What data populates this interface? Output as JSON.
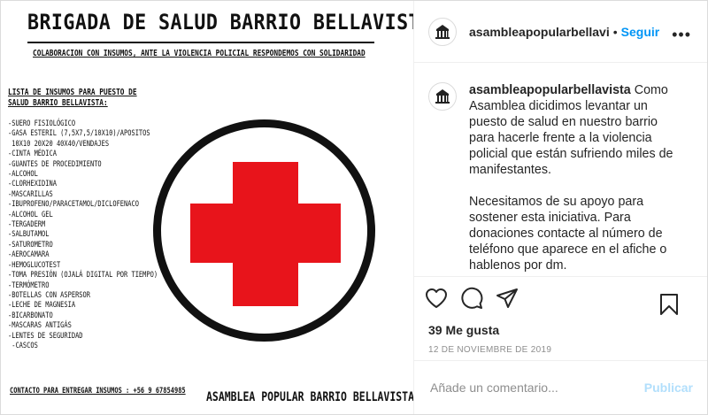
{
  "poster": {
    "title": "BRIGADA DE SALUD BARRIO BELLAVISTA",
    "subtitle": "COLABORACION CON INSUMOS, ANTE LA VIOLENCIA POLICIAL RESPONDEMOS CON SOLIDARIDAD",
    "list_title_line1": "LISTA DE INSUMOS PARA PUESTO DE",
    "list_title_line2": "SALUD BARRIO BELLAVISTA:",
    "supplies": [
      "-SUERO FISIOLÓGICO",
      "-GASA ESTERIL (7,5X7,5/10X10)/APOSITOS",
      " 10X10 20X20 40X40/VENDAJES",
      "-CINTA MÉDICA",
      "-GUANTES DE PROCEDIMIENTO",
      "-ALCOHOL",
      "-CLORHEXIDINA",
      "-MASCARILLAS",
      "-IBUPROFENO/PARACETAMOL/DICLOFENACO",
      "-ALCOHOL GEL",
      "-TERGADERM",
      "-SALBUTAMOL",
      "-SATUROMETRO",
      "-AEROCAMARA",
      "-HEMOGLUCOTEST",
      "-TOMA PRESIÓN (OJALÁ DIGITAL POR TIEMPO)",
      "-TERMÓMETRO",
      "-BOTELLAS CON ASPERSOR",
      "-LECHE DE MAGNESIA",
      "-BICARBONATO",
      "-MASCARAS ANTIGÁS",
      "-LENTES DE SEGURIDAD",
      " -CASCOS"
    ],
    "contact": "CONTACTO PARA ENTREGAR INSUMOS : +56 9 67854985",
    "footer": "ASAMBLEA POPULAR BARRIO BELLAVISTA",
    "cross_color": "#e8141b"
  },
  "header": {
    "username": "asambleapopularbellavi",
    "separator": "•",
    "follow_label": "Seguir",
    "more_label": "•••"
  },
  "caption": {
    "username": "asambleapopularbellavista",
    "text1": "Como Asamblea dicidimos levantar un puesto de salud en nuestro barrio para hacerle frente a la violencia policial que están sufriendo miles de manifestantes.",
    "text2": "Necesitamos de su apoyo para sostener esta iniciativa. Para donaciones contacte al número de teléfono que aparece en el afiche o hablenos por dm.",
    "text3": "--"
  },
  "actions": {
    "icons": [
      "heart-icon",
      "comment-icon",
      "share-icon",
      "bookmark-icon"
    ]
  },
  "likes": "39 Me gusta",
  "date": "12 DE NOVIEMBRE DE 2019",
  "comment": {
    "placeholder": "Añade un comentario...",
    "publish_label": "Publicar"
  },
  "colors": {
    "accent": "#0095f6",
    "publish_disabled": "#b2dffc"
  }
}
